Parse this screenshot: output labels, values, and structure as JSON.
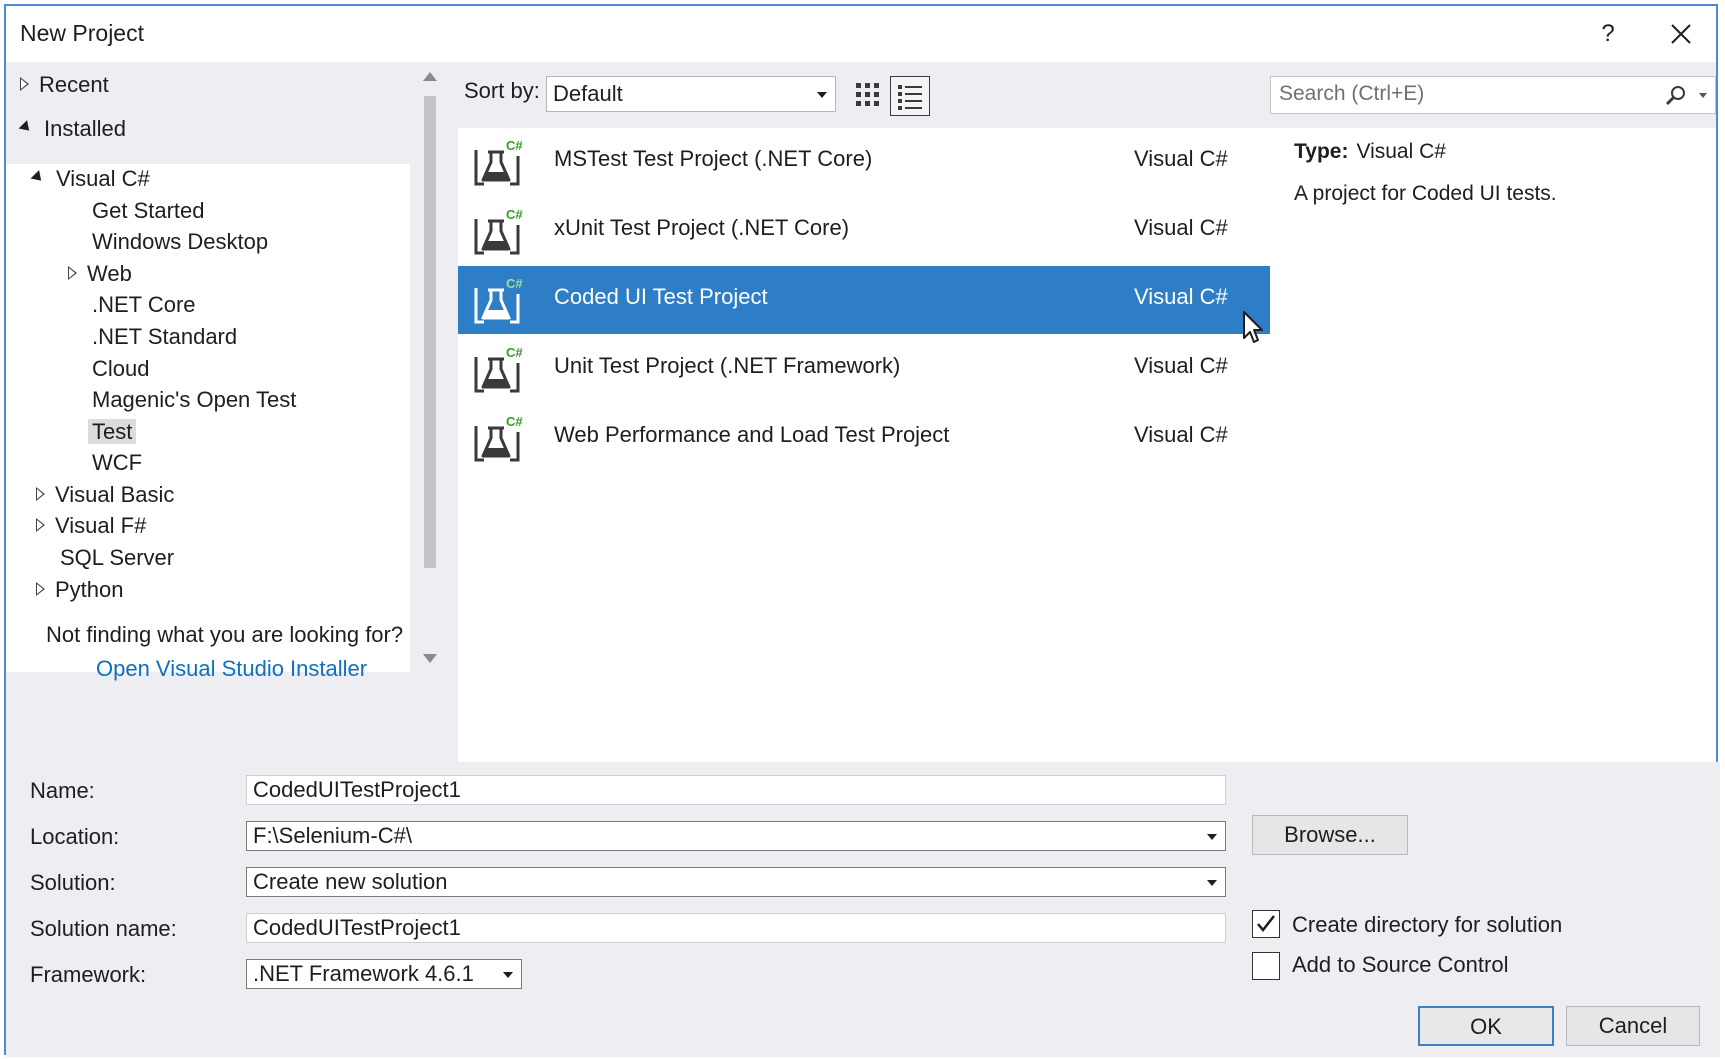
{
  "window": {
    "title": "New Project",
    "help_label": "?"
  },
  "tree": {
    "top_items": [
      {
        "label": "Recent",
        "state": "collapsed"
      },
      {
        "label": "Installed",
        "state": "expanded"
      }
    ],
    "items": [
      {
        "label": "Visual C#",
        "state": "expanded"
      },
      {
        "label": "Get Started"
      },
      {
        "label": "Windows Desktop"
      },
      {
        "label": "Web",
        "state": "collapsed"
      },
      {
        "label": ".NET Core"
      },
      {
        "label": ".NET Standard"
      },
      {
        "label": "Cloud"
      },
      {
        "label": "Magenic's Open Test"
      },
      {
        "label": "Test",
        "selected": true
      },
      {
        "label": "WCF"
      },
      {
        "label": "Visual Basic",
        "state": "collapsed"
      },
      {
        "label": "Visual F#",
        "state": "collapsed"
      },
      {
        "label": "SQL Server"
      },
      {
        "label": "Python",
        "state": "collapsed"
      }
    ],
    "not_finding": "Not finding what you are looking for?",
    "installer_link": "Open Visual Studio Installer"
  },
  "toolbar": {
    "sort_label": "Sort by:",
    "sort_value": "Default",
    "search_placeholder": "Search (Ctrl+E)"
  },
  "templates": [
    {
      "name": "MSTest Test Project (.NET Core)",
      "language": "Visual C#",
      "badge": "C#",
      "selected": false
    },
    {
      "name": "xUnit Test Project (.NET Core)",
      "language": "Visual C#",
      "badge": "C#",
      "selected": false
    },
    {
      "name": "Coded UI Test Project",
      "language": "Visual C#",
      "badge": "C#",
      "selected": true
    },
    {
      "name": "Unit Test Project (.NET Framework)",
      "language": "Visual C#",
      "badge": "C#",
      "selected": false
    },
    {
      "name": "Web Performance and Load Test Project",
      "language": "Visual C#",
      "badge": "C#",
      "selected": false
    }
  ],
  "details": {
    "type_label": "Type:",
    "type_value": "Visual C#",
    "description": "A project for Coded UI tests."
  },
  "form": {
    "name_label": "Name:",
    "name_value": "CodedUITestProject1",
    "location_label": "Location:",
    "location_value": "F:\\Selenium-C#\\",
    "solution_label": "Solution:",
    "solution_value": "Create new solution",
    "solution_name_label": "Solution name:",
    "solution_name_value": "CodedUITestProject1",
    "framework_label": "Framework:",
    "framework_value": ".NET Framework 4.6.1",
    "browse_label": "Browse...",
    "create_dir_label": "Create directory for solution",
    "create_dir_checked": true,
    "source_control_label": "Add to Source Control",
    "source_control_checked": false,
    "ok_label": "OK",
    "cancel_label": "Cancel"
  },
  "colors": {
    "selection": "#2e7dc7",
    "link": "#0e70c0",
    "badge_green": "#3a9a2b",
    "border_accent": "#4f8ad8"
  }
}
